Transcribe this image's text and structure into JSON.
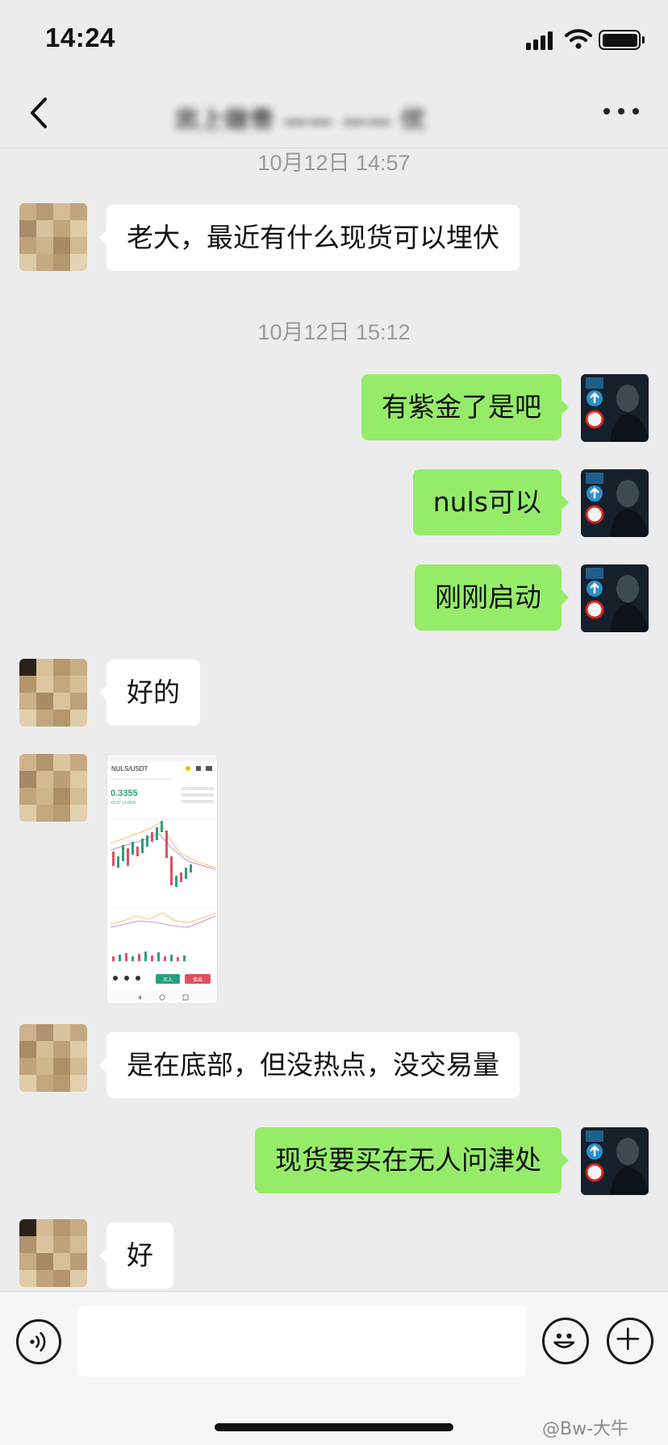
{
  "status_bar": {
    "time": "14:24"
  },
  "header": {
    "title": "忠上做贵 ——  —— 优"
  },
  "messages": {
    "stamp1": "10月12日 14:57",
    "m1": "老大，最近有什么现货可以埋伏",
    "stamp2": "10月12日 15:12",
    "m2": "有紫金了是吧",
    "m3": "nuls可以",
    "m4": "刚刚启动",
    "m5": "好的",
    "m7": "是在底部，但没热点，没交易量",
    "m8": "现货要买在无人问津处",
    "m9": "好"
  },
  "image_message": {
    "pair": "NULS/USDT",
    "price": "0.3355",
    "change": "+0.37 +1.56%",
    "buy_label": "买入",
    "sell_label": "卖出"
  },
  "input_bar": {
    "placeholder": ""
  },
  "watermark": "@Bw-大牛",
  "colors": {
    "outgoing_bubble": "#95ec69",
    "incoming_bubble": "#ffffff",
    "background": "#ececec",
    "kline_up": "#26a17b",
    "kline_down": "#e04f5f"
  },
  "icons": [
    "back-arrow-icon",
    "more-dots-icon",
    "signal-icon",
    "wifi-icon",
    "battery-icon",
    "voice-icon",
    "emoji-icon",
    "plus-icon"
  ]
}
